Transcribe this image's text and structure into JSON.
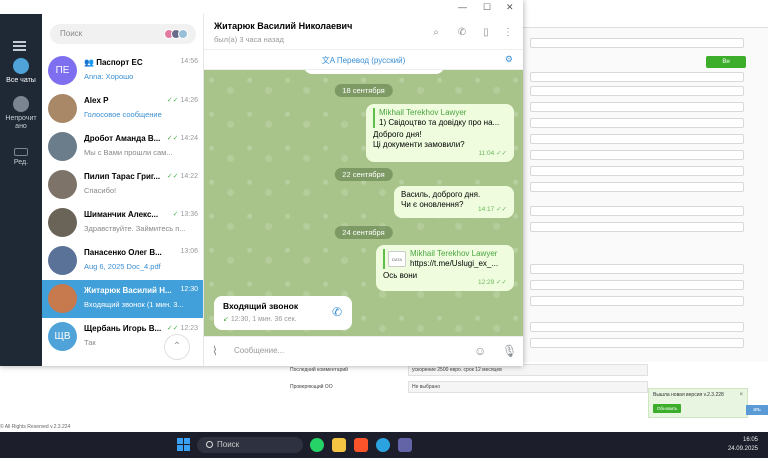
{
  "background_app": {
    "green_button": "Вн",
    "rows": [
      {
        "label": "Последний комментарий",
        "value": "ускорение 2500 евро. срок 12 месяцев"
      },
      {
        "label": "Проверяющий ОО",
        "value": "Не выбрано"
      }
    ],
    "footer": "© All Rights Reserved v.2.3.224",
    "update_notice": {
      "text": "Вышла новая версия v.2.3.228",
      "button": "Обновить",
      "close": "×"
    },
    "blue_label": "ать"
  },
  "taskbar": {
    "search_placeholder": "Поиск",
    "time": "16:05",
    "date": "24.09.2025"
  },
  "telegram": {
    "window_buttons": {
      "minimize": "—",
      "maximize": "☐",
      "close": "✕"
    },
    "rail": {
      "all_chats": "Все чаты",
      "unread": "Непрочит ано",
      "edit": "Ред."
    },
    "search_placeholder": "Поиск",
    "chats": [
      {
        "name": "Паспорт ЕС",
        "time": "14:56",
        "message": "Anna: Хорошо",
        "initials": "ПЕ",
        "color": "#7e6ff0",
        "blue": true,
        "group": true
      },
      {
        "name": "Alex P",
        "time": "14:26",
        "message": "Голосовое сообщение",
        "initials": "",
        "color": "#a98868",
        "blue": true,
        "tick": "✓✓"
      },
      {
        "name": "Дробот Аманда В...",
        "time": "14:24",
        "message": "Мы с Вами прошли сам...",
        "initials": "",
        "color": "#6b7c8a",
        "tick": "✓✓"
      },
      {
        "name": "Пилип Тарас Григ...",
        "time": "14:22",
        "message": "Спасибо!",
        "initials": "",
        "color": "#7d7368",
        "tick": "✓✓"
      },
      {
        "name": "Шиманчик Алекс...",
        "time": "13:36",
        "message": "Здравствуйте. Займитесь п...",
        "initials": "",
        "color": "#6a6458",
        "tick": "✓"
      },
      {
        "name": "Панасенко Олег В...",
        "time": "13:06",
        "message": "Aug 6, 2025 Doc_4.pdf",
        "initials": "",
        "color": "#5b7298",
        "blue": true
      },
      {
        "name": "Житарюк Василий Н...",
        "time": "12:30",
        "message": "Входящий звонок (1 мин. 3...",
        "initials": "",
        "color": "#c77a4e",
        "active": true
      },
      {
        "name": "Щербань Игорь В...",
        "time": "12:23",
        "message": "Так",
        "initials": "ЩВ",
        "color": "#4fa3d8",
        "tick": "✓✓"
      }
    ],
    "header": {
      "name": "Житарюк Василий Николаевич",
      "status": "был(а) 3 часа назад"
    },
    "translate_bar": "Перевод (русский)",
    "messages": [
      {
        "type": "date",
        "text": "18 сентября"
      },
      {
        "type": "out",
        "reply_name": "Mikhail Terekhov Lawyer",
        "reply_text": "1) Свідоцтво та довідку про на...",
        "lines": [
          "Доброго дня!",
          "Ці документи замовили?"
        ],
        "time": "11:04"
      },
      {
        "type": "date",
        "text": "22 сентября"
      },
      {
        "type": "out",
        "lines": [
          "Василь, доброго дня.",
          "Чи є оновлення?"
        ],
        "time": "14:17"
      },
      {
        "type": "date",
        "text": "24 сентября"
      },
      {
        "type": "out",
        "preview_name": "Mikhail Terekhov Lawyer",
        "preview_link": "https://t.me/Uslugi_ex_...",
        "preview_logo": "DATA",
        "lines": [
          "Ось вони"
        ],
        "time": "12:29"
      },
      {
        "type": "call",
        "title": "Входящий звонок",
        "detail": "12:30, 1 мин. 36 сек."
      }
    ],
    "input_placeholder": "Сообщение..."
  }
}
